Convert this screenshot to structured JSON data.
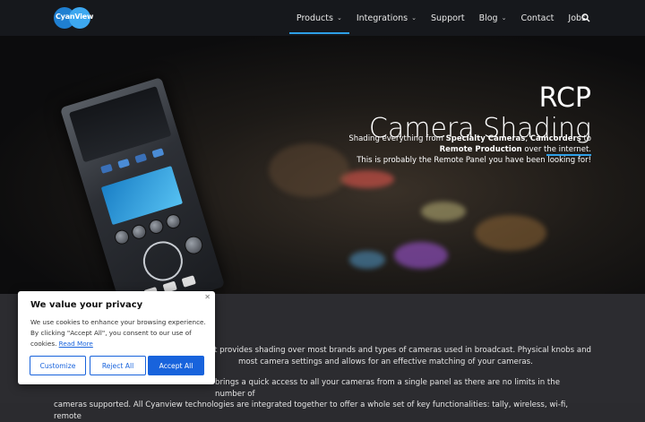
{
  "brand": {
    "logo_text": "CyanView"
  },
  "nav": {
    "items": [
      {
        "label": "Products",
        "has_dropdown": true,
        "active": true
      },
      {
        "label": "Integrations",
        "has_dropdown": true,
        "active": false
      },
      {
        "label": "Support",
        "has_dropdown": false,
        "active": false
      },
      {
        "label": "Blog",
        "has_dropdown": true,
        "active": false
      },
      {
        "label": "Contact",
        "has_dropdown": false,
        "active": false
      },
      {
        "label": "Jobs",
        "has_dropdown": false,
        "active": false
      }
    ],
    "search_icon": "search-icon",
    "accent_color": "#2d9fe6"
  },
  "hero": {
    "title_line1": "RCP",
    "title_line2": "Camera Shading",
    "line1_pre": "Shading everything from ",
    "line1_bold1": "Specialty Cameras",
    "line1_sep": ", ",
    "line1_bold2": "Camcorders",
    "line1_post": " to",
    "line2_bold": "Remote Production",
    "line2_post": " over the internet.",
    "line3": "This is probably the Remote Panel you have been looking for!"
  },
  "content": {
    "para1_line1": "nel that provides shading over most brands and types of cameras used in broadcast. Physical knobs and",
    "para1_line2": "most camera settings and allows for an effective matching of your cameras.",
    "para2_line1": "brings a quick access to all your cameras from a single panel as there are no limits in the number of",
    "para2_line2": "cameras supported. All Cyanview technologies are integrated together to offer a whole set of key functionalities: tally, wireless, wi-fi, remote"
  },
  "cookie": {
    "title": "We value your privacy",
    "body": "We use cookies to enhance your browsing experience. By clicking \"Accept All\", you consent to our use of cookies. ",
    "read_more": "Read More",
    "customize_label": "Customize",
    "reject_label": "Reject All",
    "accept_label": "Accept All",
    "close_glyph": "✕",
    "button_color": "#1863dc"
  }
}
